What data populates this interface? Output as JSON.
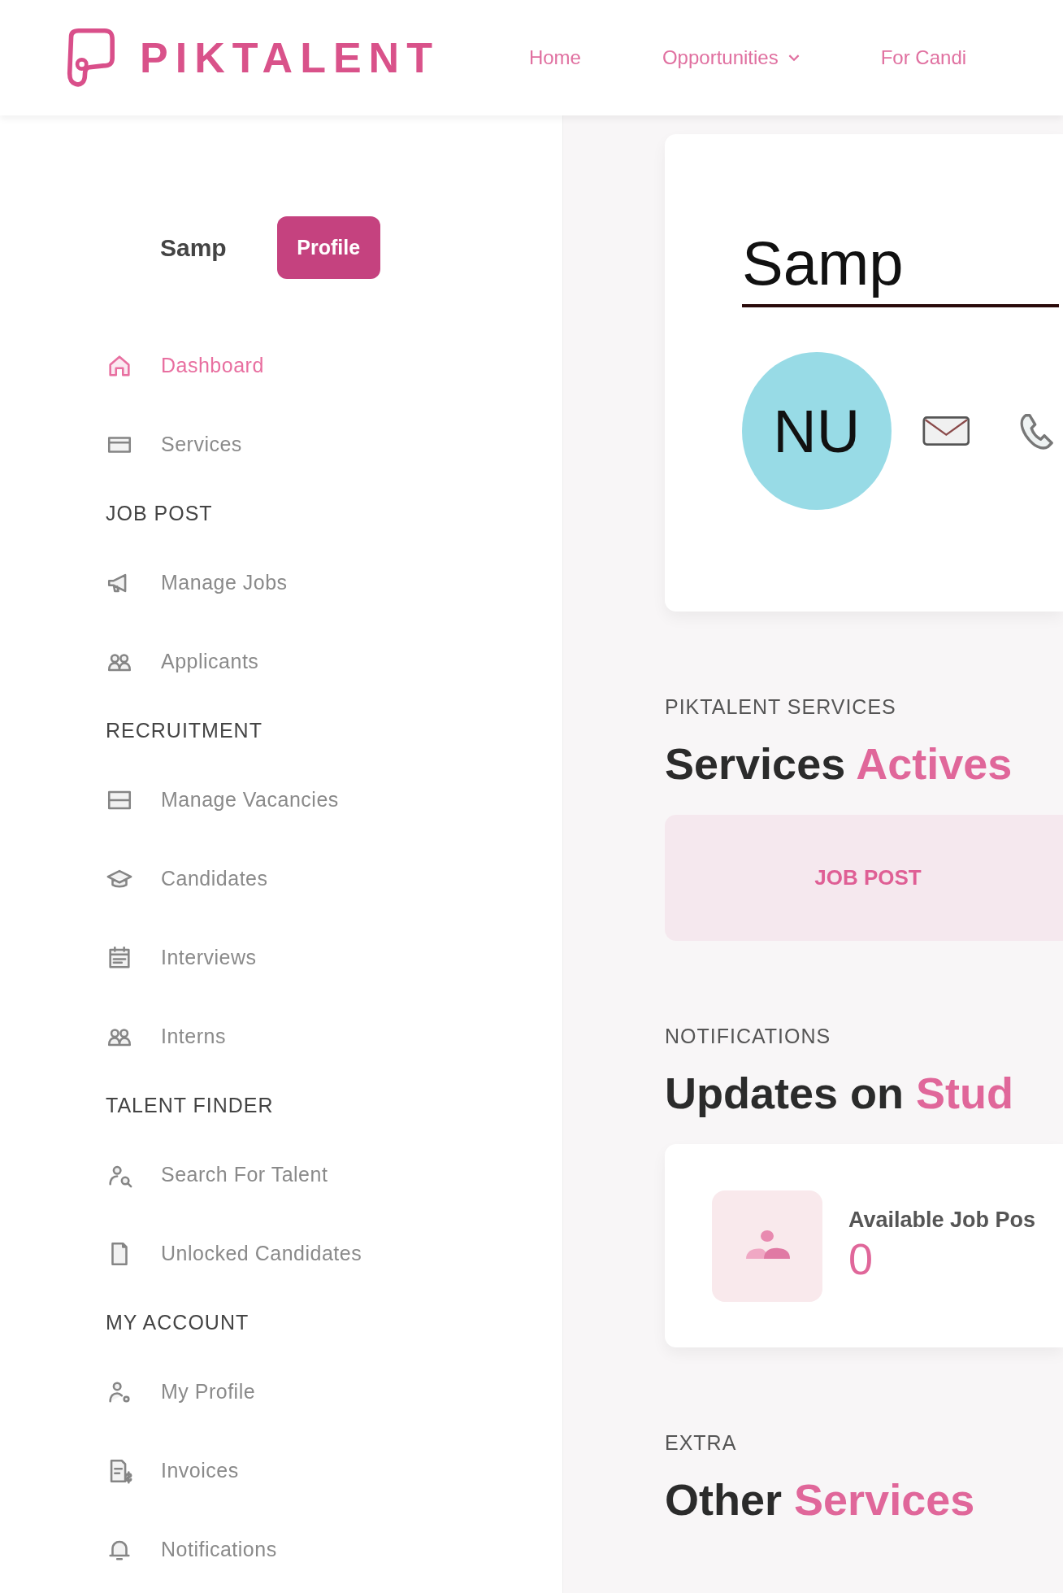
{
  "header": {
    "brand": "PIKTALENT",
    "nav": [
      {
        "label": "Home",
        "dropdown": false
      },
      {
        "label": "Opportunities",
        "dropdown": true
      },
      {
        "label": "For Candi",
        "dropdown": false
      }
    ]
  },
  "sidebar": {
    "user_name": "Samp",
    "profile_button": "Profile",
    "items": [
      {
        "kind": "link",
        "label": "Dashboard",
        "selected": true
      },
      {
        "kind": "link",
        "label": "Services",
        "selected": false
      },
      {
        "kind": "heading",
        "label": "JOB POST"
      },
      {
        "kind": "link",
        "label": "Manage Jobs",
        "selected": false
      },
      {
        "kind": "link",
        "label": "Applicants",
        "selected": false
      },
      {
        "kind": "heading",
        "label": "RECRUITMENT"
      },
      {
        "kind": "link",
        "label": "Manage Vacancies",
        "selected": false
      },
      {
        "kind": "link",
        "label": "Candidates",
        "selected": false
      },
      {
        "kind": "link",
        "label": "Interviews",
        "selected": false
      },
      {
        "kind": "link",
        "label": "Interns",
        "selected": false
      },
      {
        "kind": "heading",
        "label": "TALENT FINDER"
      },
      {
        "kind": "link",
        "label": "Search For Talent",
        "selected": false
      },
      {
        "kind": "link",
        "label": "Unlocked Candidates",
        "selected": false
      },
      {
        "kind": "heading",
        "label": "MY ACCOUNT"
      },
      {
        "kind": "link",
        "label": "My Profile",
        "selected": false
      },
      {
        "kind": "link",
        "label": "Invoices",
        "selected": false
      },
      {
        "kind": "link",
        "label": "Notifications",
        "selected": false
      }
    ]
  },
  "profile_card": {
    "name": "Samp",
    "initials": "NU"
  },
  "sections": [
    {
      "kind": "services",
      "kicker": "PIKTALENT SERVICES",
      "title": "Services",
      "highlight": "Actives",
      "services": [
        "JOB POST"
      ]
    },
    {
      "kind": "stats",
      "kicker": "NOTIFICATIONS",
      "title": "Updates on",
      "highlight": "Stud",
      "stats": [
        {
          "label": "Available Job Pos",
          "value": "0"
        }
      ]
    },
    {
      "kind": "plain",
      "kicker": "EXTRA",
      "title": "Other",
      "highlight": "Services"
    }
  ]
}
